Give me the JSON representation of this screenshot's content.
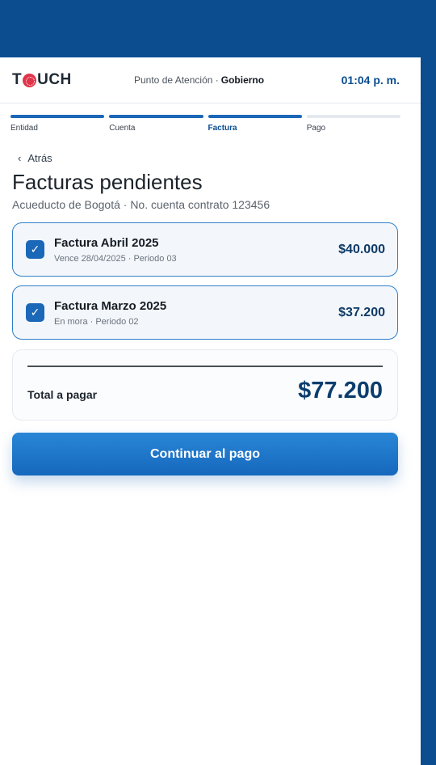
{
  "header": {
    "logo_prefix": "T",
    "logo_suffix": "UCH",
    "place_label": "Punto de Atención ·",
    "place_value": "Gobierno",
    "time": "01:04 p. m."
  },
  "steps": [
    {
      "label": "Entidad",
      "state": "done"
    },
    {
      "label": "Cuenta",
      "state": "done"
    },
    {
      "label": "Factura",
      "state": "active"
    },
    {
      "label": "Pago",
      "state": "pending"
    }
  ],
  "nav": {
    "back_label": "Atrás"
  },
  "page": {
    "title": "Facturas pendientes",
    "subtitle": "Acueducto de Bogotá · No. cuenta contrato 123456"
  },
  "invoices": [
    {
      "title": "Factura Abril 2025",
      "meta": "Vence 28/04/2025 · Periodo 03",
      "amount": "$40.000",
      "checked": true
    },
    {
      "title": "Factura Marzo 2025",
      "meta": "En mora · Periodo 02",
      "amount": "$37.200",
      "checked": true
    }
  ],
  "summary": {
    "total_label": "Total a pagar",
    "total_amount": "$77.200"
  },
  "cta": {
    "label": "Continuar al pago"
  },
  "colors": {
    "brand_blue": "#0b4d8f",
    "accent": "#1b67b8",
    "logo_red": "#e0344a"
  }
}
